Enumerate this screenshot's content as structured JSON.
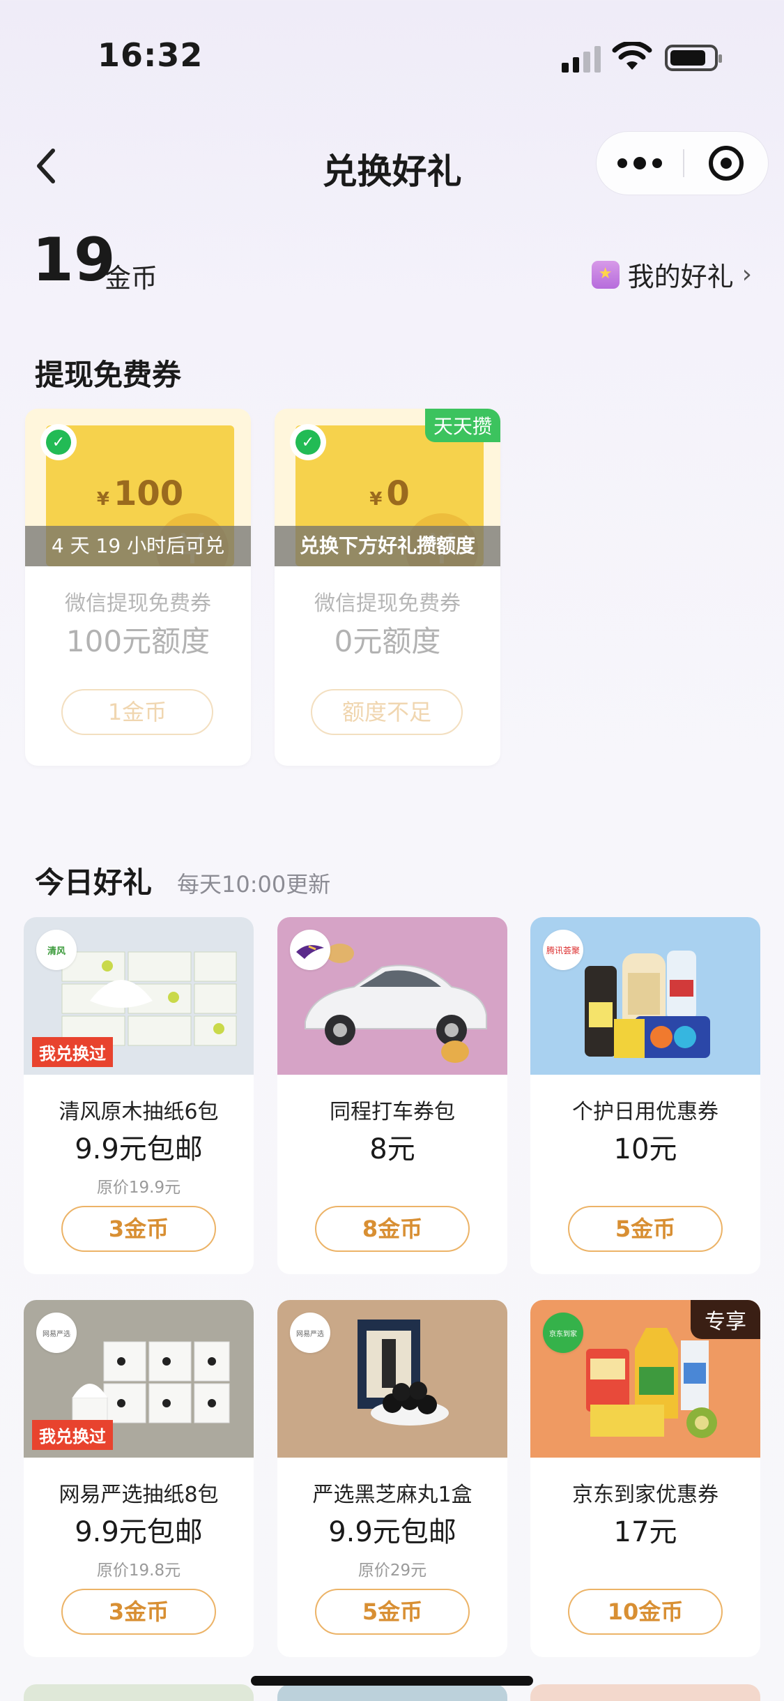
{
  "status": {
    "time": "16:32"
  },
  "nav": {
    "title": "兑换好礼"
  },
  "coins": {
    "count": "19",
    "unit": "金币",
    "my_gifts_label": "我的好礼"
  },
  "free_section": {
    "title": "提现免费券",
    "vouchers": [
      {
        "amount": "100",
        "currency": "¥",
        "overlay": "4 天 19 小时后可兑",
        "label": "微信提现免费券",
        "quota": "100元额度",
        "button": "1金币",
        "tag": ""
      },
      {
        "amount": "0",
        "currency": "¥",
        "overlay": "兑换下方好礼攒额度",
        "label": "微信提现免费券",
        "quota": "0元额度",
        "button": "额度不足",
        "tag": "天天攒"
      }
    ]
  },
  "today_section": {
    "title": "今日好礼",
    "subtitle": "每天10:00更新",
    "items": [
      {
        "name": "清风原木抽纸6包",
        "price": "9.9元包邮",
        "original": "原价19.9元",
        "button": "3金币",
        "badge": "我兑换过",
        "exclusive": "",
        "brand": "清风"
      },
      {
        "name": "同程打车券包",
        "price": "8元",
        "original": "",
        "button": "8金币",
        "badge": "",
        "exclusive": "",
        "brand": ""
      },
      {
        "name": "个护日用优惠券",
        "price": "10元",
        "original": "",
        "button": "5金币",
        "badge": "",
        "exclusive": "",
        "brand": "腾讯荟聚"
      },
      {
        "name": "网易严选抽纸8包",
        "price": "9.9元包邮",
        "original": "原价19.8元",
        "button": "3金币",
        "badge": "我兑换过",
        "exclusive": "",
        "brand": "网易严选"
      },
      {
        "name": "严选黑芝麻丸1盒",
        "price": "9.9元包邮",
        "original": "原价29元",
        "button": "5金币",
        "badge": "",
        "exclusive": "",
        "brand": "网易严选"
      },
      {
        "name": "京东到家优惠券",
        "price": "17元",
        "original": "",
        "button": "10金币",
        "badge": "",
        "exclusive": "专享",
        "brand": "京东到家"
      }
    ]
  },
  "colors": {
    "accent": "#d88f33",
    "voucher_yellow": "#f6d24c",
    "green_tag": "#3cc35e",
    "redeemed_red": "#e8432e"
  }
}
